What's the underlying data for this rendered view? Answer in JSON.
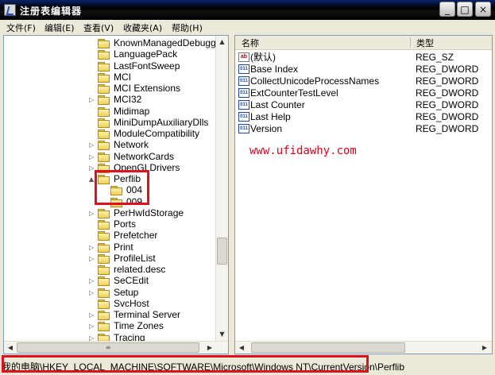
{
  "window": {
    "title": "注册表编辑器"
  },
  "menu": [
    "文件(F)",
    "编辑(E)",
    "查看(V)",
    "收藏夹(A)",
    "帮助(H)"
  ],
  "tree": {
    "items": [
      {
        "label": "KnownManagedDebugging",
        "expandable": false
      },
      {
        "label": "LanguagePack",
        "expandable": false
      },
      {
        "label": "LastFontSweep",
        "expandable": false
      },
      {
        "label": "MCI",
        "expandable": false
      },
      {
        "label": "MCI Extensions",
        "expandable": false
      },
      {
        "label": "MCI32",
        "expandable": true
      },
      {
        "label": "Midimap",
        "expandable": false
      },
      {
        "label": "MiniDumpAuxiliaryDlls",
        "expandable": false
      },
      {
        "label": "ModuleCompatibility",
        "expandable": false
      },
      {
        "label": "Network",
        "expandable": true
      },
      {
        "label": "NetworkCards",
        "expandable": true
      },
      {
        "label": "OpenGLDrivers",
        "expandable": true
      },
      {
        "label": "Perflib",
        "expandable": true,
        "expanded": true
      },
      {
        "label": "004",
        "expandable": false,
        "child": true
      },
      {
        "label": "009",
        "expandable": false,
        "child": true
      },
      {
        "label": "PerHwIdStorage",
        "expandable": true
      },
      {
        "label": "Ports",
        "expandable": false
      },
      {
        "label": "Prefetcher",
        "expandable": false
      },
      {
        "label": "Print",
        "expandable": true
      },
      {
        "label": "ProfileList",
        "expandable": true
      },
      {
        "label": "related.desc",
        "expandable": false
      },
      {
        "label": "SeCEdit",
        "expandable": true
      },
      {
        "label": "Setup",
        "expandable": true
      },
      {
        "label": "SvcHost",
        "expandable": false
      },
      {
        "label": "Terminal Server",
        "expandable": true
      },
      {
        "label": "Time Zones",
        "expandable": true
      },
      {
        "label": "Tracing",
        "expandable": true
      }
    ],
    "scroll_thumb_grip": "≡"
  },
  "list": {
    "columns": {
      "name": "名称",
      "type": "类型"
    },
    "rows": [
      {
        "icon": "string-value-icon",
        "glyph": "ab",
        "name": "(默认)",
        "type": "REG_SZ"
      },
      {
        "icon": "dword-value-icon",
        "glyph": "011",
        "name": "Base Index",
        "type": "REG_DWORD"
      },
      {
        "icon": "dword-value-icon",
        "glyph": "011",
        "name": "CollectUnicodeProcessNames",
        "type": "REG_DWORD"
      },
      {
        "icon": "dword-value-icon",
        "glyph": "011",
        "name": "ExtCounterTestLevel",
        "type": "REG_DWORD"
      },
      {
        "icon": "dword-value-icon",
        "glyph": "011",
        "name": "Last Counter",
        "type": "REG_DWORD"
      },
      {
        "icon": "dword-value-icon",
        "glyph": "011",
        "name": "Last Help",
        "type": "REG_DWORD"
      },
      {
        "icon": "dword-value-icon",
        "glyph": "011",
        "name": "Version",
        "type": "REG_DWORD"
      }
    ]
  },
  "watermark": "www.ufidawhy.com",
  "status": {
    "path": "我的电脑\\HKEY_LOCAL_MACHINE\\SOFTWARE\\Microsoft\\Windows NT\\CurrentVersion\\Perflib"
  },
  "colors": {
    "highlight": "#e0101e",
    "watermark": "#e0001b"
  }
}
